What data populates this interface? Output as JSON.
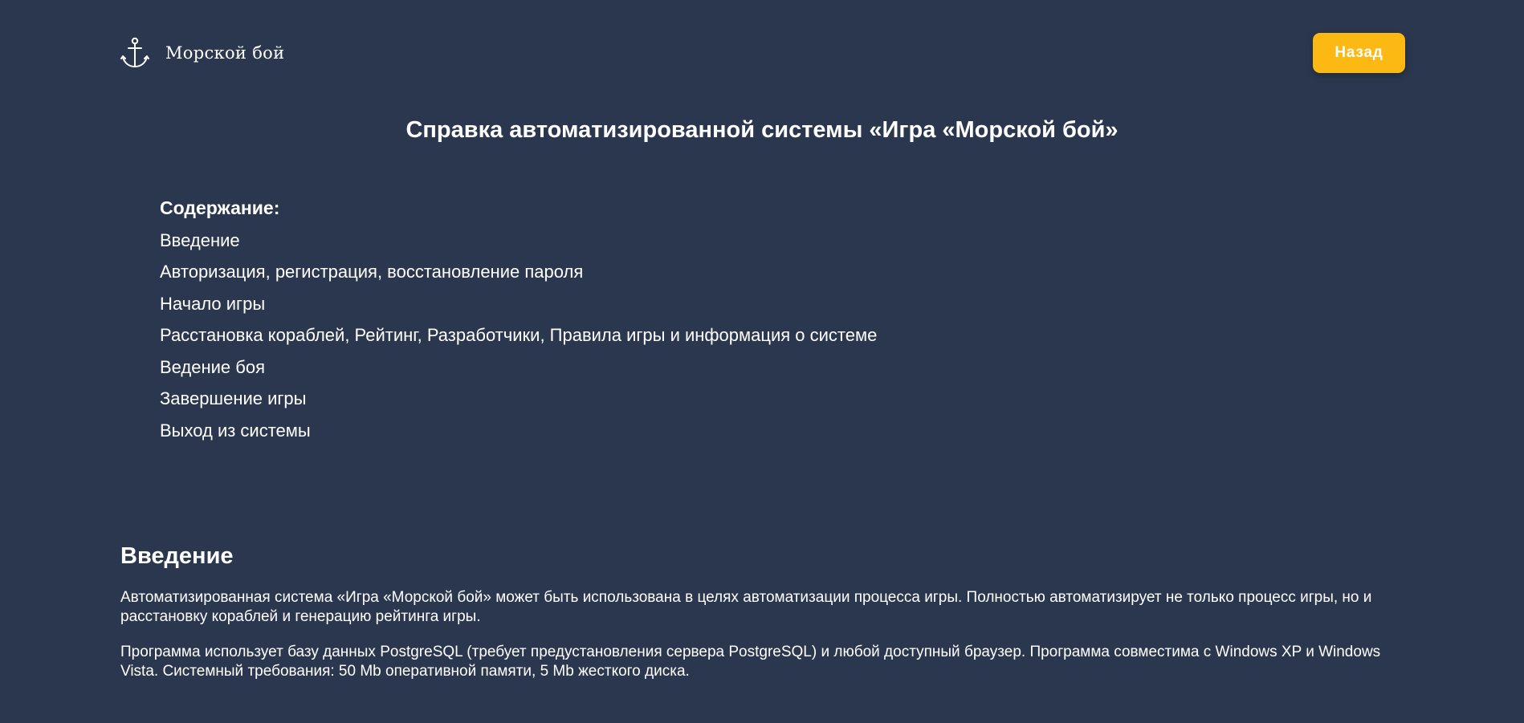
{
  "header": {
    "logo_text": "Морской бой",
    "logo_icon": "anchor-icon",
    "back_label": "Назад"
  },
  "colors": {
    "background": "#2b374e",
    "text": "#ffffff",
    "accent": "#fdb913"
  },
  "page_title": "Справка автоматизированной системы «Игра «Морской бой»",
  "toc": {
    "heading": "Содержание:",
    "items": [
      "Введение",
      "Авторизация, регистрация, восстановление пароля",
      "Начало игры",
      "Расстановка кораблей, Рейтинг, Разработчики, Правила игры и информация о системе",
      "Ведение боя",
      "Завершение игры",
      "Выход из системы"
    ]
  },
  "intro": {
    "title": "Введение",
    "paragraphs": [
      "Автоматизированная система «Игра «Морской бой» может быть использована в целях автоматизации процесса игры. Полностью автоматизирует не только процесс игры, но и расстановку кораблей и генерацию рейтинга игры.",
      "Программа использует базу данных PostgreSQL (требует предустановления сервера PostgreSQL) и любой доступный браузер. Программа совместима с Windows XP и Windows Vista. Системный требования: 50 Mb оперативной памяти, 5 Mb жесткого диска."
    ]
  }
}
